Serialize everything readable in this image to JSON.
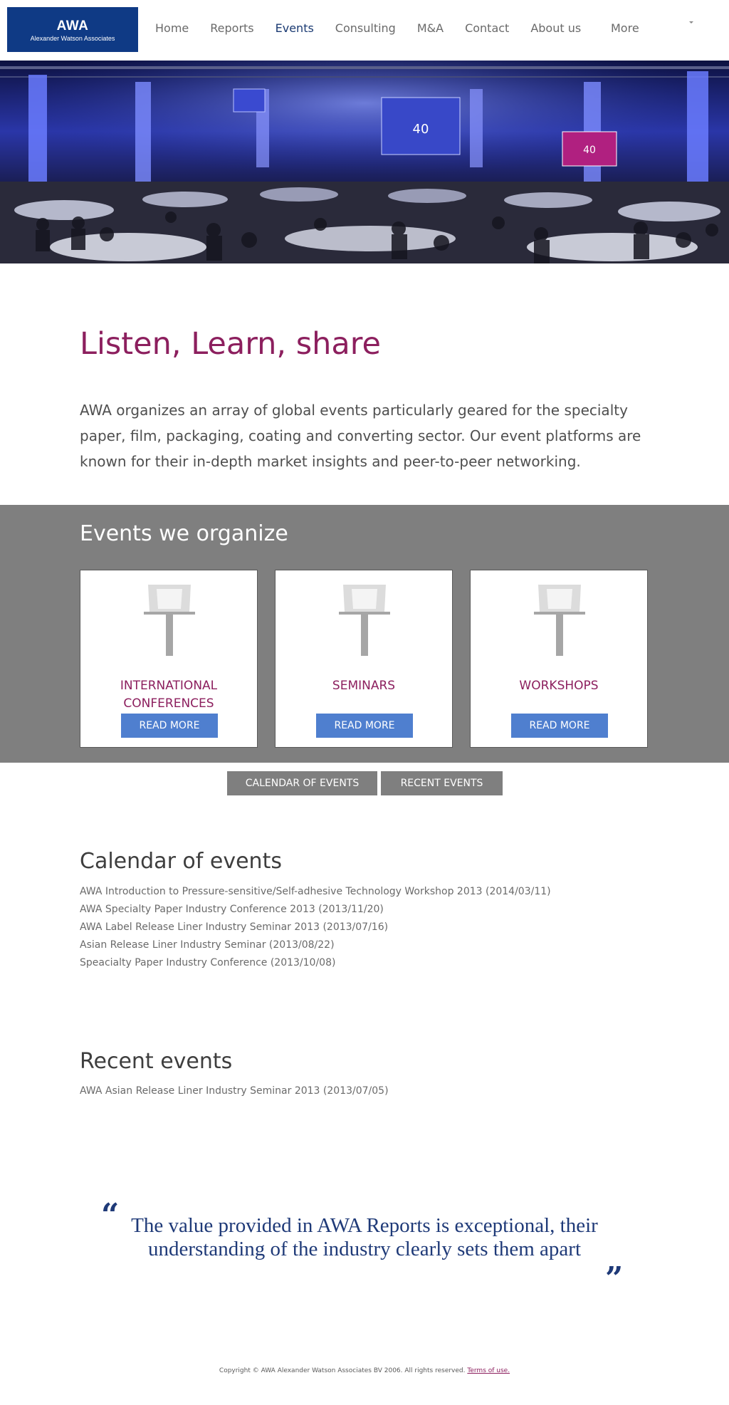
{
  "logo": {
    "main": "AWA",
    "sub": "Alexander Watson Associates"
  },
  "nav": {
    "items": [
      {
        "label": "Home"
      },
      {
        "label": "Reports"
      },
      {
        "label": "Events"
      },
      {
        "label": "Consulting"
      },
      {
        "label": "M&A"
      },
      {
        "label": "Contact"
      },
      {
        "label": "About us"
      }
    ],
    "active": "Events",
    "more_label": "More"
  },
  "intro": {
    "title": "Listen, Learn, share",
    "text": "AWA organizes an array of global events particularly geared for the specialty paper, film, packaging, coating and converting sector. Our event platforms are known for their in-depth market insights and peer-to-peer networking."
  },
  "events_band": {
    "title": "Events we organize",
    "cards": [
      {
        "title_line1": "INTERNATIONAL",
        "title_line2": "CONFERENCES",
        "button": "READ MORE"
      },
      {
        "title_line1": "SEMINARS",
        "title_line2": "",
        "button": "READ MORE"
      },
      {
        "title_line1": "WORKSHOPS",
        "title_line2": "",
        "button": "READ MORE"
      }
    ]
  },
  "tabs": {
    "calendar": "CALENDAR OF EVENTS",
    "recent": "RECENT EVENTS"
  },
  "calendar": {
    "title": "Calendar of events",
    "items": [
      "AWA Introduction to Pressure-sensitive/Self-adhesive Technology Workshop 2013 (2014/03/11)",
      "AWA Specialty Paper Industry Conference 2013 (2013/11/20)",
      "AWA Label Release Liner Industry Seminar 2013 (2013/07/16)",
      "Asian Release Liner Industry Seminar (2013/08/22)",
      "Speacialty Paper Industry Conference (2013/10/08)"
    ]
  },
  "recent": {
    "title": "Recent events",
    "items": [
      "AWA Asian Release Liner Industry Seminar 2013 (2013/07/05)"
    ]
  },
  "quote": {
    "open": "“",
    "close": "”",
    "text": "The value provided in AWA Reports is exceptional, their understanding of the industry clearly sets them apart"
  },
  "footer": {
    "copyright": "Copyright © AWA Alexander Watson Associates BV 2006. All rights reserved.",
    "terms": "Terms of use."
  },
  "colors": {
    "brand_blue": "#0f3a85",
    "accent_magenta": "#8c1f5e",
    "button_blue": "#4f7fcf",
    "band_gray": "#7f7f7f",
    "quote_navy": "#1f3a78"
  },
  "hero": {
    "screen_text_1": "40",
    "screen_text_2": "40"
  }
}
